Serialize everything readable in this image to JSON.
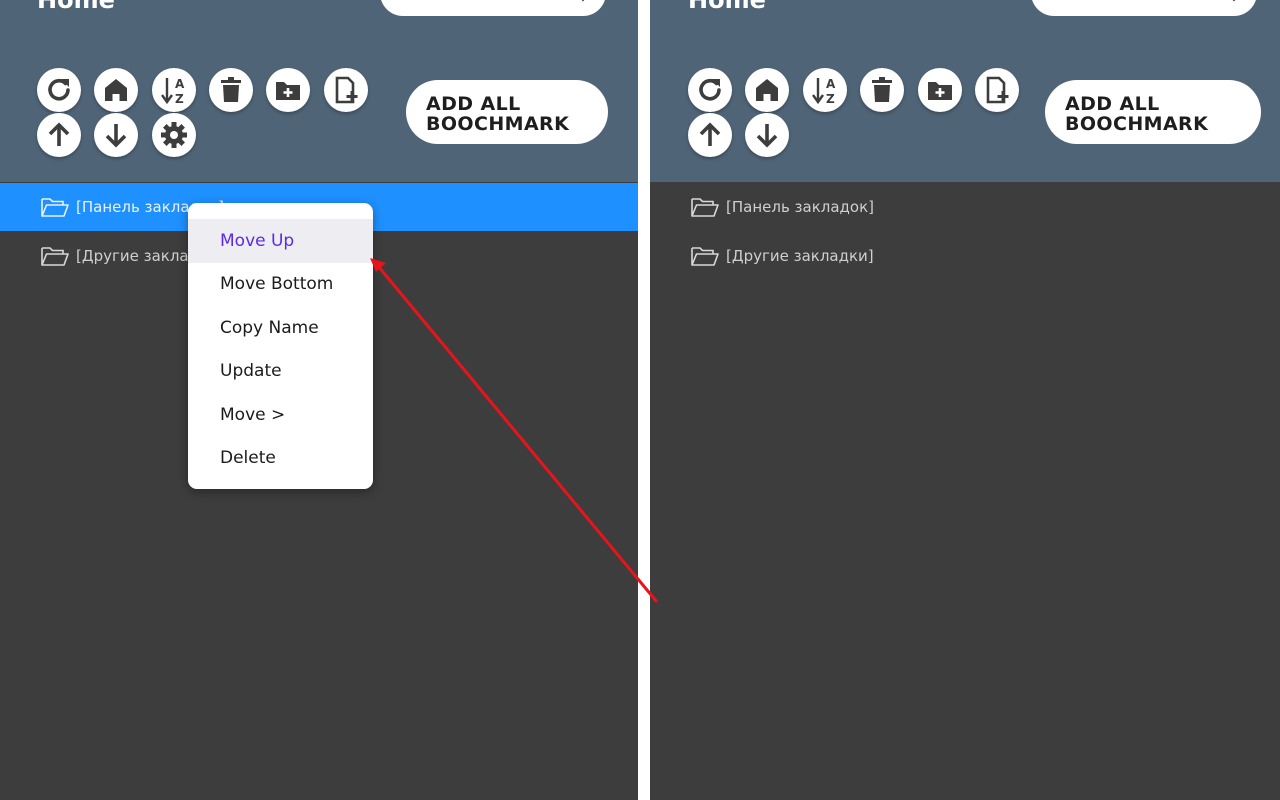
{
  "left": {
    "header": {
      "title": "Home",
      "add_all_line1": "ADD ALL",
      "add_all_line2": "BOOCHMARK"
    },
    "toolbar_icons": [
      "refresh-icon",
      "home-icon",
      "sort-alpha-icon",
      "trash-icon",
      "add-folder-icon",
      "add-bookmark-icon",
      "arrow-up-icon",
      "arrow-down-icon",
      "settings-icon"
    ],
    "items": [
      {
        "label": "[Панель закладок]",
        "selected": true
      },
      {
        "label": "[Другие закладки]",
        "selected": false
      }
    ],
    "context_menu": {
      "items": [
        {
          "label": "Move Up",
          "active": true
        },
        {
          "label": "Move Bottom"
        },
        {
          "label": "Copy Name"
        },
        {
          "label": "Update"
        },
        {
          "label": "Move >"
        },
        {
          "label": "Delete"
        }
      ]
    }
  },
  "right": {
    "header": {
      "title": "Home",
      "add_all_line1": "ADD ALL",
      "add_all_line2": "BOOCHMARK"
    },
    "toolbar_icons": [
      "refresh-icon",
      "home-icon",
      "sort-alpha-icon",
      "trash-icon",
      "add-folder-icon",
      "add-bookmark-icon",
      "arrow-up-icon",
      "arrow-down-icon"
    ],
    "items": [
      {
        "label": "[Панель закладок]",
        "selected": false
      },
      {
        "label": "[Другие закладки]",
        "selected": false
      }
    ]
  },
  "colors": {
    "header_bg": "#4f6477",
    "list_bg": "#3d3d3d",
    "selected_row": "#1e90ff",
    "menu_active_text": "#5a2be6",
    "annotation_arrow": "#e8141b"
  }
}
